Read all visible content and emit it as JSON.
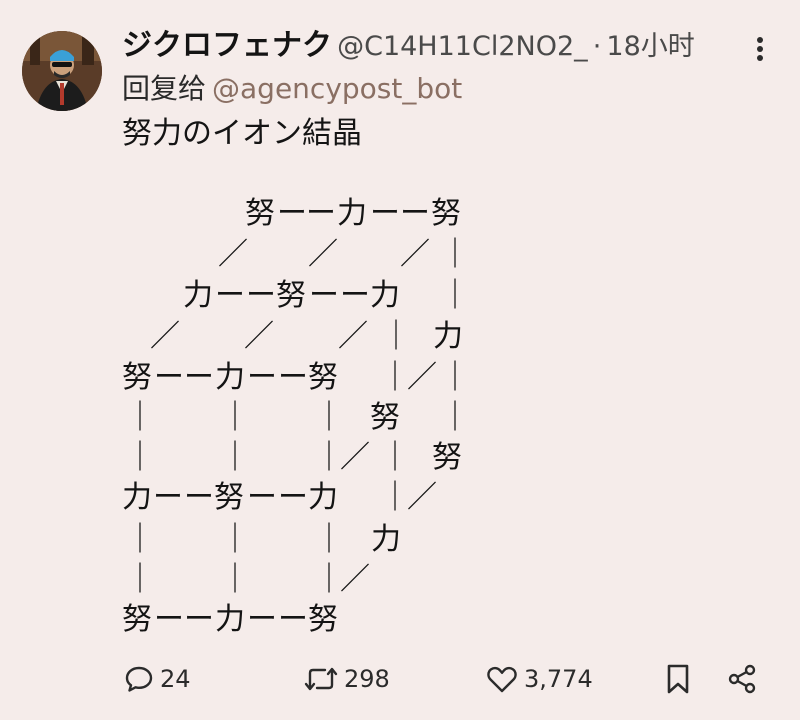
{
  "post": {
    "author": {
      "display_name": "ジクロフェナク",
      "handle": "@C14H11Cl2NO2_",
      "avatar": "avatar-photo"
    },
    "meta_dot": "·",
    "timestamp": "18小时",
    "more_icon": "more-vertical-icon",
    "reply_to": {
      "label": "回复给",
      "handle": "@agencypost_bot"
    },
    "text": "努力のイオン結晶",
    "ascii_art": {
      "glyphs": [
        "努",
        "ー",
        "力",
        "／",
        "｜"
      ]
    }
  },
  "actions": {
    "reply": {
      "icon": "comment-icon",
      "count": "24"
    },
    "repost": {
      "icon": "repost-icon",
      "count": "298"
    },
    "like": {
      "icon": "heart-icon",
      "count": "3,774"
    },
    "bookmark": {
      "icon": "bookmark-icon"
    },
    "share": {
      "icon": "share-icon"
    }
  },
  "colors": {
    "background": "#f5ecea",
    "text": "#141414",
    "muted": "#4a4a4a",
    "handle_link": "#8a6f63"
  }
}
